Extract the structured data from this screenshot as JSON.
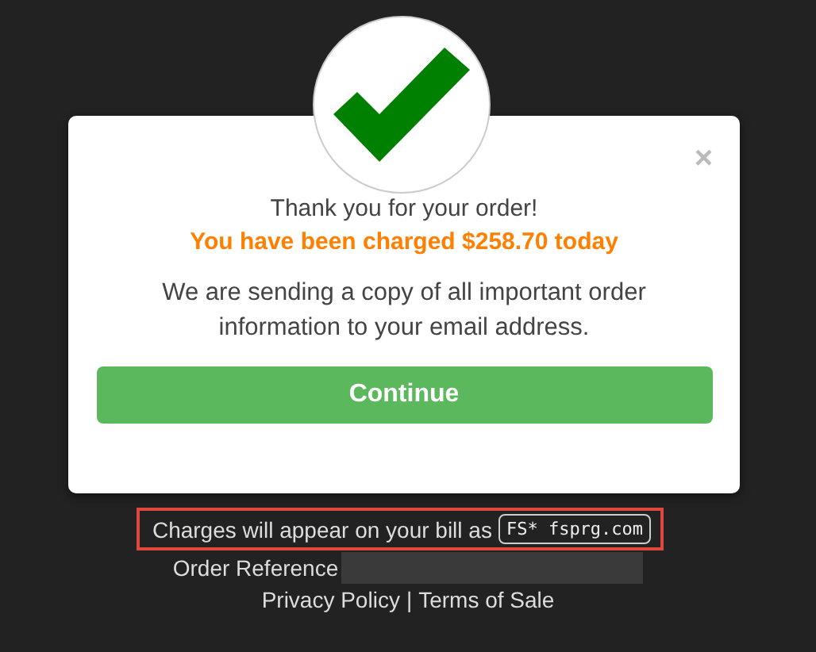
{
  "modal": {
    "close": "×",
    "heading": "Thank you for your order!",
    "charged": "You have been charged $258.70 today",
    "message": "We are sending a copy of all important order information to your email address.",
    "button": "Continue"
  },
  "billing": {
    "text": "Charges will appear on your bill as",
    "descriptor": "FS* fsprg.com",
    "highlighted": true
  },
  "order_reference": {
    "label": "Order Reference"
  },
  "links": [
    "Privacy Policy",
    "Terms of Sale"
  ],
  "separator": "|"
}
